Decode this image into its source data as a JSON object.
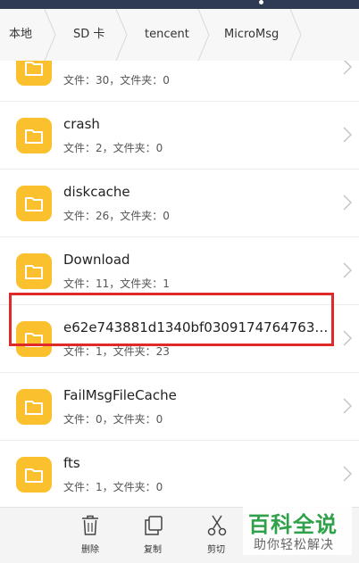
{
  "breadcrumb": [
    "本地",
    "SD 卡",
    "tencent",
    "MicroMsg"
  ],
  "folders": [
    {
      "name": "",
      "info": "文件：30，文件夹：0"
    },
    {
      "name": "crash",
      "info": "文件：2，文件夹：0"
    },
    {
      "name": "diskcache",
      "info": "文件：26，文件夹：0"
    },
    {
      "name": "Download",
      "info": "文件：11，文件夹：1"
    },
    {
      "name": "e62e743881d1340bf0309174764763…",
      "info": "文件：1，文件夹：23"
    },
    {
      "name": "FailMsgFileCache",
      "info": "文件：0，文件夹：0"
    },
    {
      "name": "fts",
      "info": "文件：1，文件夹：0"
    }
  ],
  "toolbar": {
    "delete_label": "删除",
    "copy_label": "复制",
    "cut_label": "剪切"
  },
  "watermark": {
    "brand": "百科全说",
    "slogan": "助你轻松解决"
  },
  "colors": {
    "folder": "#fbc02d",
    "highlight": "#e02a2a",
    "statusbar": "#2f3b55",
    "watermark": "#2fa14a"
  }
}
